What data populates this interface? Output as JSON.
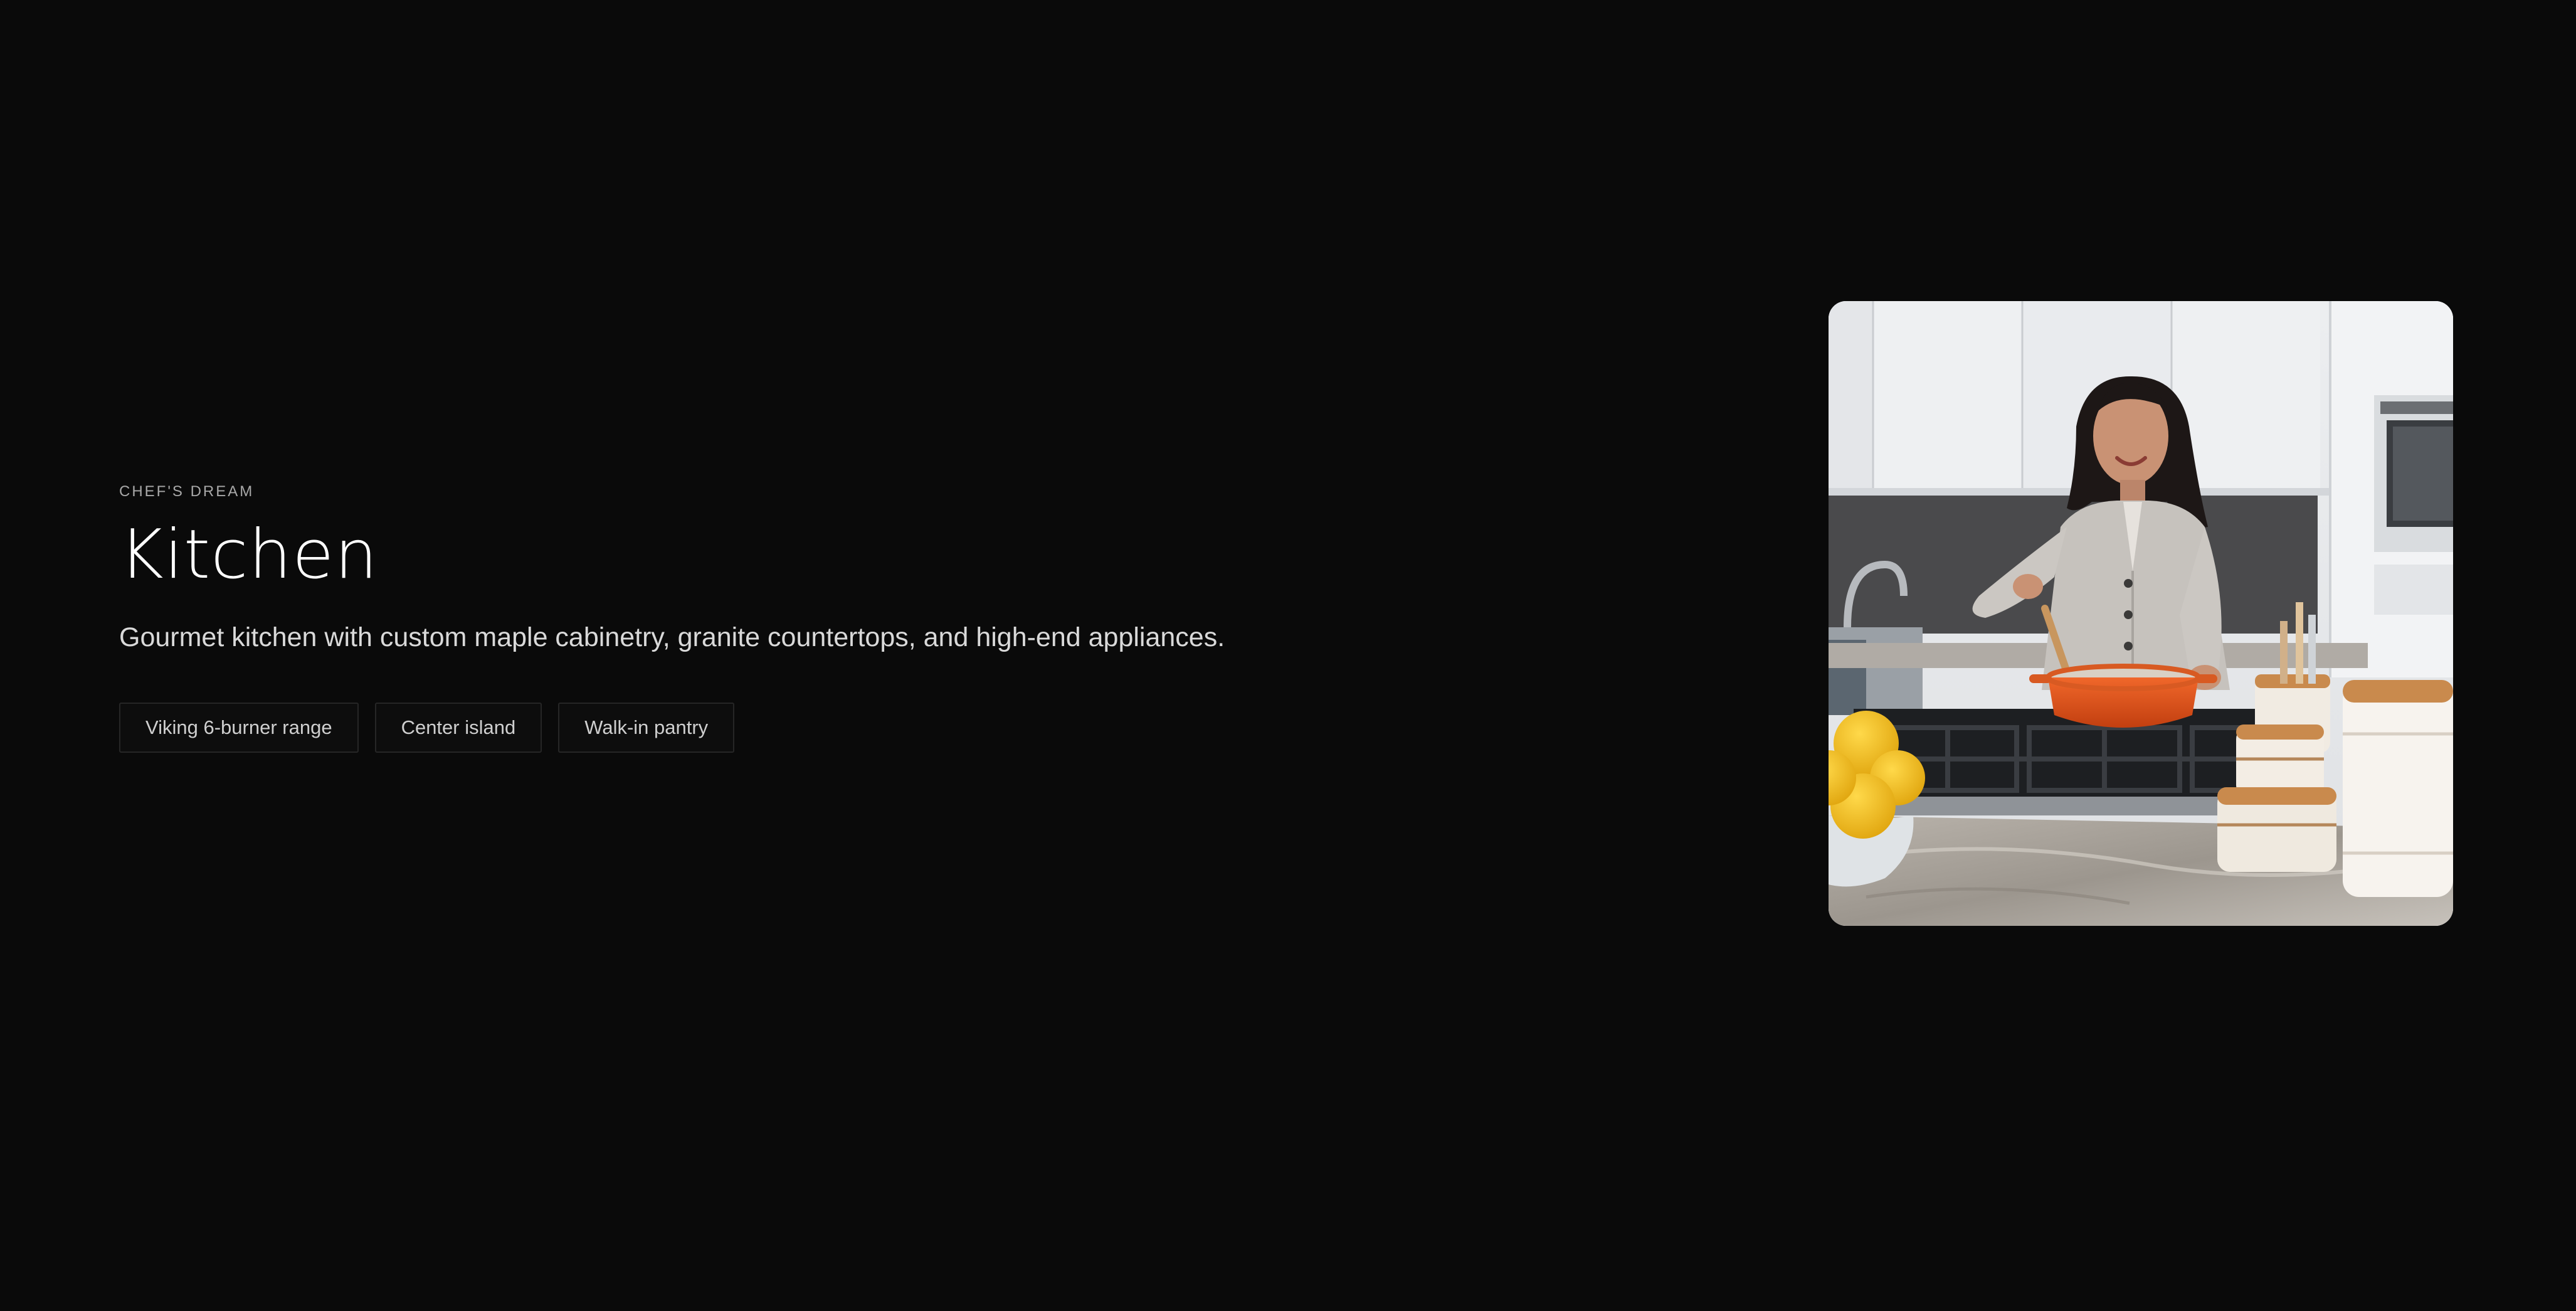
{
  "section": {
    "eyebrow": "CHEF'S DREAM",
    "title": "Kitchen",
    "description": "Gourmet kitchen with custom maple cabinetry, granite countertops, and high-end appliances.",
    "features": [
      "Viking 6-burner range",
      "Center island",
      "Walk-in pantry"
    ]
  },
  "photo": {
    "subject": "woman-cooking-in-kitchen"
  },
  "colors": {
    "background": "#0a0a0a",
    "text": "#ffffff",
    "muted": "#a8a8a8",
    "tag_border": "#262626",
    "pot": "#e8531a",
    "lemon": "#f4c020"
  }
}
